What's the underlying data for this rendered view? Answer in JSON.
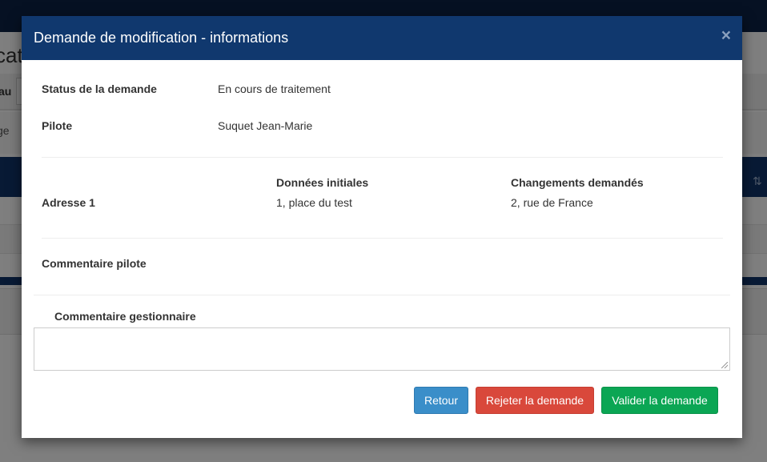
{
  "background": {
    "title_fragment": "cati",
    "band1_label": "au",
    "band2_label": "ge"
  },
  "modal": {
    "title": "Demande de modification - informations",
    "close_label": "×",
    "status": {
      "label": "Status de la demande",
      "value": "En cours de traitement"
    },
    "pilote": {
      "label": "Pilote",
      "value": "Suquet Jean-Marie"
    },
    "changes": {
      "col_initial": "Données initiales",
      "col_requested": "Changements demandés",
      "rows": [
        {
          "label": "Adresse 1",
          "initial": "1, place du test",
          "requested": "2, rue de France"
        }
      ]
    },
    "commentaire_pilote": {
      "label": "Commentaire pilote",
      "value": ""
    },
    "commentaire_gestionnaire": {
      "label": "Commentaire gestionnaire",
      "value": ""
    },
    "buttons": {
      "back": "Retour",
      "reject": "Rejeter la demande",
      "validate": "Valider la demande"
    },
    "colors": {
      "header": "#10386e",
      "back": "#3a8ec9",
      "reject": "#d9483b",
      "validate": "#0ba654"
    }
  }
}
